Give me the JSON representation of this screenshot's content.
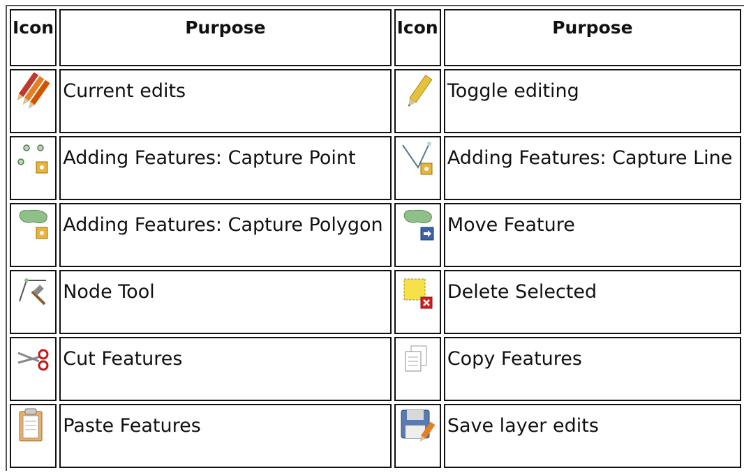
{
  "table": {
    "headers": [
      "Icon",
      "Purpose",
      "Icon",
      "Purpose"
    ],
    "rows": [
      {
        "left": {
          "icon": "current-edits-icon",
          "purpose": "Current edits"
        },
        "right": {
          "icon": "toggle-editing-icon",
          "purpose": "Toggle editing"
        }
      },
      {
        "left": {
          "icon": "capture-point-icon",
          "purpose": "Adding Features: Capture Point"
        },
        "right": {
          "icon": "capture-line-icon",
          "purpose": "Adding Features: Capture Line"
        }
      },
      {
        "left": {
          "icon": "capture-polygon-icon",
          "purpose": "Adding Features: Capture Polygon"
        },
        "right": {
          "icon": "move-feature-icon",
          "purpose": "Move Feature"
        }
      },
      {
        "left": {
          "icon": "node-tool-icon",
          "purpose": "Node Tool"
        },
        "right": {
          "icon": "delete-selected-icon",
          "purpose": "Delete Selected"
        }
      },
      {
        "left": {
          "icon": "cut-features-icon",
          "purpose": "Cut Features"
        },
        "right": {
          "icon": "copy-features-icon",
          "purpose": "Copy Features"
        }
      },
      {
        "left": {
          "icon": "paste-features-icon",
          "purpose": "Paste Features"
        },
        "right": {
          "icon": "save-layer-edits-icon",
          "purpose": "Save layer edits"
        }
      }
    ]
  }
}
